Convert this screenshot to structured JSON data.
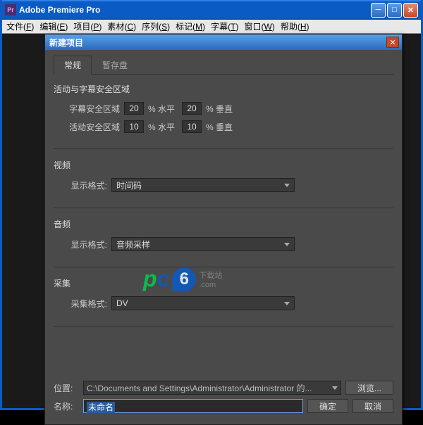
{
  "window": {
    "title": "Adobe Premiere Pro",
    "icon_text": "Pr"
  },
  "menubar": {
    "items": [
      {
        "label": "文件",
        "key": "F"
      },
      {
        "label": "编辑",
        "key": "E"
      },
      {
        "label": "项目",
        "key": "P"
      },
      {
        "label": "素材",
        "key": "C"
      },
      {
        "label": "序列",
        "key": "S"
      },
      {
        "label": "标记",
        "key": "M"
      },
      {
        "label": "字幕",
        "key": "T"
      },
      {
        "label": "窗口",
        "key": "W"
      },
      {
        "label": "帮助",
        "key": "H"
      }
    ]
  },
  "dialog": {
    "title": "新建项目",
    "tabs": {
      "general": "常规",
      "scratch": "暂存盘"
    },
    "safe_area": {
      "title": "活动与字幕安全区域",
      "title_safe_label": "字幕安全区域",
      "action_safe_label": "活动安全区域",
      "title_h": "20",
      "title_v": "20",
      "action_h": "10",
      "action_v": "10",
      "h_unit": "% 水平",
      "v_unit": "% 垂直"
    },
    "video": {
      "title": "视频",
      "format_label": "显示格式:",
      "format_value": "时间码"
    },
    "audio": {
      "title": "音频",
      "format_label": "显示格式:",
      "format_value": "音频采样"
    },
    "capture": {
      "title": "采集",
      "format_label": "采集格式:",
      "format_value": "DV"
    },
    "location": {
      "label": "位置:",
      "path": "C:\\Documents and Settings\\Administrator\\Administrator 的...",
      "browse": "浏览..."
    },
    "name": {
      "label": "名称:",
      "value": "未命名"
    },
    "buttons": {
      "ok": "确定",
      "cancel": "取消"
    }
  },
  "watermark": {
    "p": "p",
    "c": "c",
    "six": "6",
    "text": "下载站",
    "com": ".com"
  }
}
